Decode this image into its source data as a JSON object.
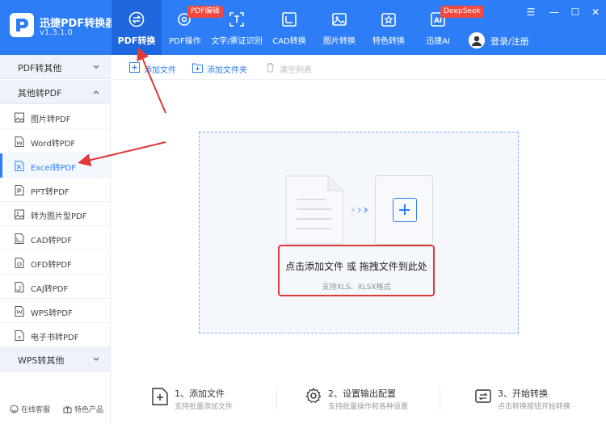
{
  "app": {
    "title": "迅捷PDF转换器",
    "version": "v1.3.1.0",
    "brand_color": "#2d7ef6"
  },
  "nav": [
    {
      "label": "PDF转换",
      "icon": "convert-icon",
      "active": true
    },
    {
      "label": "PDF操作",
      "icon": "pdf-operation-icon",
      "tag": "PDF编辑"
    },
    {
      "label": "文字/票证识别",
      "icon": "ocr-icon"
    },
    {
      "label": "CAD转换",
      "icon": "cad-icon"
    },
    {
      "label": "图片转换",
      "icon": "image-icon"
    },
    {
      "label": "特色转换",
      "icon": "star-icon"
    },
    {
      "label": "迅捷AI",
      "icon": "ai-icon",
      "tag": "DeepSeek"
    }
  ],
  "login": {
    "label": "登录/注册"
  },
  "sidebar": {
    "groups": [
      {
        "label": "PDF转其他",
        "expanded": false
      },
      {
        "label": "其他转PDF",
        "expanded": true
      },
      {
        "label": "WPS转其他",
        "expanded": false
      }
    ],
    "items": [
      {
        "label": "图片转PDF",
        "icon": "image-file-icon"
      },
      {
        "label": "Word转PDF",
        "icon": "word-file-icon"
      },
      {
        "label": "Excel转PDF",
        "icon": "excel-file-icon",
        "active": true
      },
      {
        "label": "PPT转PDF",
        "icon": "ppt-file-icon"
      },
      {
        "label": "转为图片型PDF",
        "icon": "image-pdf-icon"
      },
      {
        "label": "CAD转PDF",
        "icon": "cad-file-icon"
      },
      {
        "label": "OFD转PDF",
        "icon": "ofd-file-icon"
      },
      {
        "label": "CAJ转PDF",
        "icon": "caj-file-icon"
      },
      {
        "label": "WPS转PDF",
        "icon": "wps-file-icon"
      },
      {
        "label": "电子书转PDF",
        "icon": "ebook-file-icon"
      }
    ],
    "footer": {
      "support": "在线客服",
      "featured": "特色产品"
    }
  },
  "toolbar": {
    "add_file": "添加文件",
    "add_folder": "添加文件夹",
    "clear_list": "清空列表"
  },
  "dropzone": {
    "main": "点击添加文件 或 拖拽文件到此处",
    "sub": "支持XLS、XLSX格式"
  },
  "steps": [
    {
      "title": "1、添加文件",
      "desc": "支持批量添加文件",
      "icon": "add-file-icon"
    },
    {
      "title": "2、设置输出配置",
      "desc": "支持批量操作和各种设置",
      "icon": "settings-icon"
    },
    {
      "title": "3、开始转换",
      "desc": "点击转换按钮开始转换",
      "icon": "start-convert-icon"
    }
  ],
  "colors": {
    "accent": "#2d7ef6",
    "annotation": "#e0393a",
    "tag": "#f2483f"
  }
}
